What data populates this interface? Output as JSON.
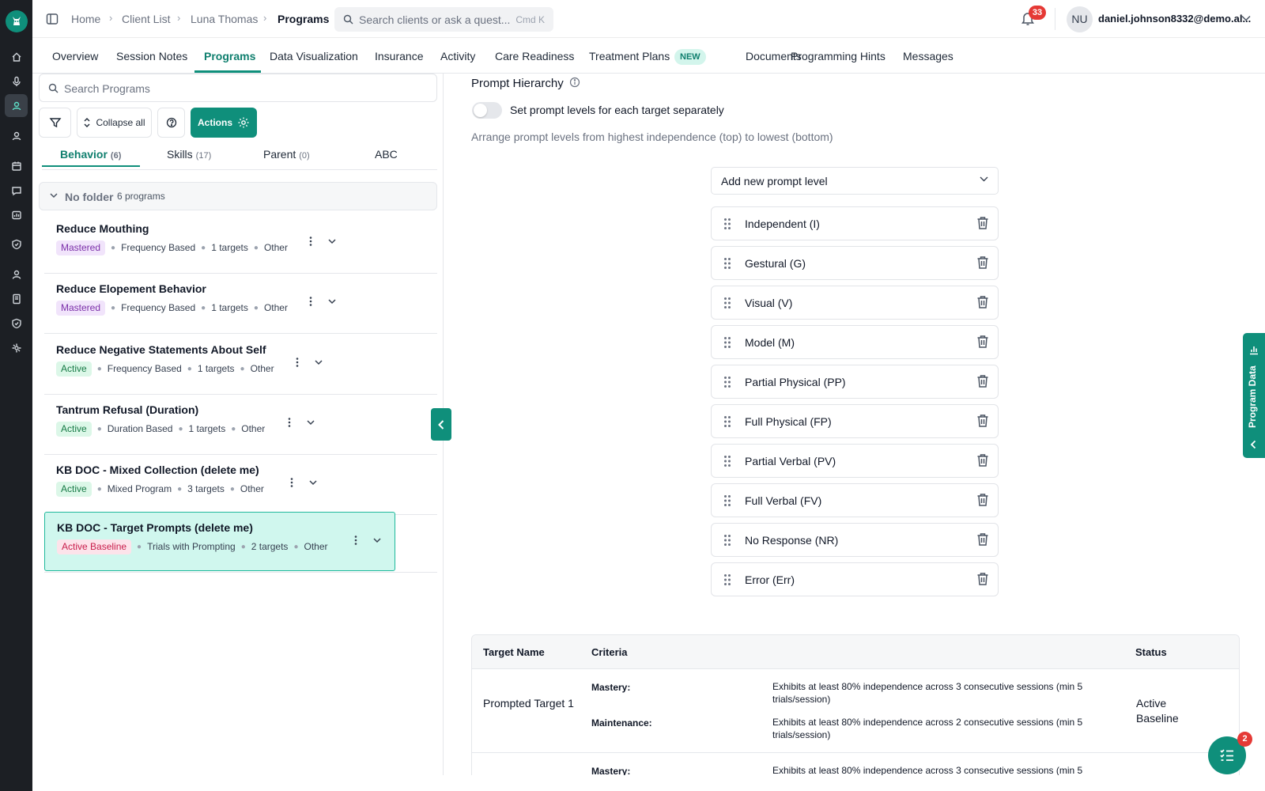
{
  "breadcrumb": {
    "items": [
      "Home",
      "Client List",
      "Luna Thomas",
      "Programs"
    ]
  },
  "search": {
    "placeholder": "Search clients or ask a quest...",
    "shortcut": "Cmd K"
  },
  "notifications": {
    "count": "33"
  },
  "user": {
    "initials": "NU",
    "email": "daniel.johnson8332@demo.al..."
  },
  "tabs": [
    {
      "label": "Overview"
    },
    {
      "label": "Session Notes"
    },
    {
      "label": "Programs"
    },
    {
      "label": "Data Visualization"
    },
    {
      "label": "Insurance"
    },
    {
      "label": "Activity"
    },
    {
      "label": "Care Readiness"
    },
    {
      "label": "Treatment Plans"
    },
    {
      "label": "Documents"
    },
    {
      "label": "Programming Hints"
    },
    {
      "label": "Messages"
    }
  ],
  "tab_new_badge": "NEW",
  "programs_panel": {
    "search_placeholder": "Search Programs",
    "collapse_label": "Collapse all",
    "actions_label": "Actions",
    "subtabs": [
      {
        "label": "Behavior",
        "count": "(6)"
      },
      {
        "label": "Skills",
        "count": "(17)"
      },
      {
        "label": "Parent",
        "count": "(0)"
      },
      {
        "label": "ABC",
        "count": ""
      }
    ],
    "folder": {
      "name": "No folder",
      "count": "6 programs"
    },
    "programs": [
      {
        "title": "Reduce Mouthing",
        "status": "Mastered",
        "type": "Frequency Based",
        "targets": "1 targets",
        "category": "Other"
      },
      {
        "title": "Reduce Elopement Behavior",
        "status": "Mastered",
        "type": "Frequency Based",
        "targets": "1 targets",
        "category": "Other"
      },
      {
        "title": "Reduce Negative Statements About Self",
        "status": "Active",
        "type": "Frequency Based",
        "targets": "1 targets",
        "category": "Other"
      },
      {
        "title": "Tantrum Refusal (Duration)",
        "status": "Active",
        "type": "Duration Based",
        "targets": "1 targets",
        "category": "Other"
      },
      {
        "title": "KB DOC - Mixed Collection (delete me)",
        "status": "Active",
        "type": "Mixed Program",
        "targets": "3 targets",
        "category": "Other"
      },
      {
        "title": "KB DOC - Target Prompts (delete me)",
        "status": "Active Baseline",
        "type": "Trials with Prompting",
        "targets": "2 targets",
        "category": "Other"
      }
    ]
  },
  "prompt_hierarchy": {
    "title": "Prompt Hierarchy",
    "toggle_label": "Set prompt levels for each target separately",
    "help_text": "Arrange prompt levels from highest independence (top) to lowest (bottom)",
    "add_placeholder": "Add new prompt level",
    "levels": [
      "Independent (I)",
      "Gestural (G)",
      "Visual (V)",
      "Model (M)",
      "Partial Physical (PP)",
      "Full Physical (FP)",
      "Partial Verbal (PV)",
      "Full Verbal (FV)",
      "No Response (NR)",
      "Error (Err)"
    ]
  },
  "targets_table": {
    "headers": {
      "name": "Target Name",
      "criteria": "Criteria",
      "status": "Status"
    },
    "rows": [
      {
        "name": "Prompted Target 1",
        "mastery_label": "Mastery:",
        "mastery": "Exhibits at least 80% independence across 3 consecutive sessions (min 5 trials/session)",
        "maintenance_label": "Maintenance:",
        "maintenance": "Exhibits at least 80% independence across 2 consecutive sessions (min 5 trials/session)",
        "status": "Active Baseline"
      },
      {
        "mastery_label": "Mastery:",
        "mastery": "Exhibits at least 80% independence across 3 consecutive sessions (min 5"
      }
    ]
  },
  "side_tab": {
    "label": "Program Data"
  },
  "fab": {
    "badge": "2"
  },
  "colors": {
    "brand": "#0f8f7b",
    "selected_bg": "#d0f7ee",
    "danger": "#e53935"
  }
}
